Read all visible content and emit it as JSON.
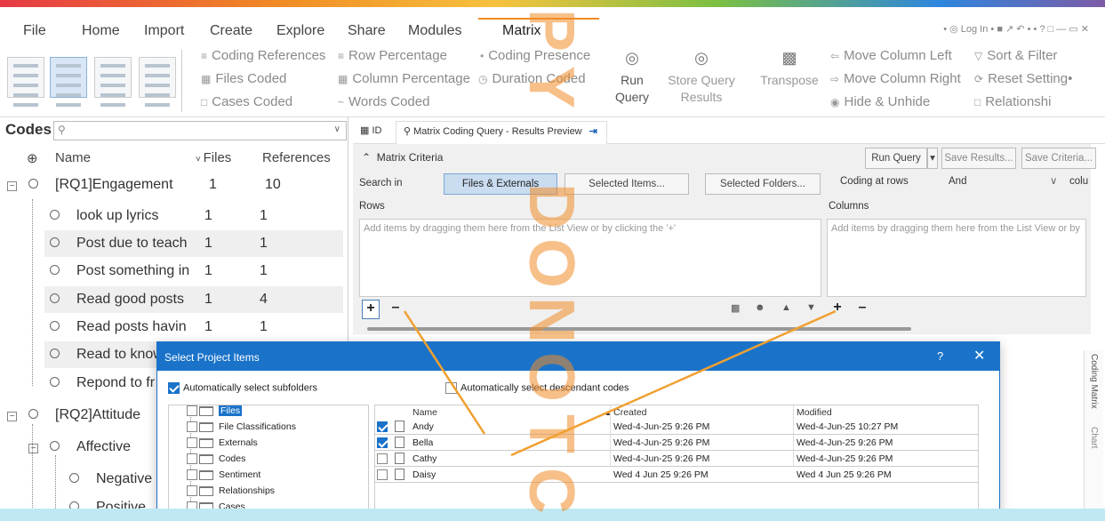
{
  "menu": {
    "items": [
      "File",
      "Home",
      "Import",
      "Create",
      "Explore",
      "Share",
      "Modules",
      "Matrix"
    ],
    "active": "Matrix",
    "login": "Log In"
  },
  "ribbon": {
    "coding_references": "Coding References",
    "row_percentage": "Row Percentage",
    "coding_presence": "Coding Presence",
    "files_coded": "Files Coded",
    "column_percentage": "Column Percentage",
    "duration_coded": "Duration Coded",
    "cases_coded": "Cases Coded",
    "words_coded": "Words Coded",
    "run_query_1": "Run",
    "run_query_2": "Query",
    "store_query_1": "Store Query",
    "store_query_2": "Results",
    "transpose": "Transpose",
    "move_column_left": "Move Column Left",
    "move_column_right": "Move Column Right",
    "hide_unhide": "Hide & Unhide",
    "sort_filter": "Sort & Filter",
    "reset_settings": "Reset Setting•",
    "relationship": "Relationshi"
  },
  "codes_panel": {
    "title": "Codes",
    "columns": {
      "name": "Name",
      "files": "Files",
      "references": "References"
    },
    "rows": [
      {
        "name": "[RQ1]Engagement",
        "files": "1",
        "refs": "10"
      },
      {
        "name": "look up lyrics",
        "files": "1",
        "refs": "1"
      },
      {
        "name": "Post due to teach",
        "files": "1",
        "refs": "1"
      },
      {
        "name": "Post something in",
        "files": "1",
        "refs": "1"
      },
      {
        "name": "Read good posts",
        "files": "1",
        "refs": "4"
      },
      {
        "name": "Read posts havin",
        "files": "1",
        "refs": "1"
      },
      {
        "name": "Read to know",
        "files": "",
        "refs": ""
      },
      {
        "name": "Repond to fr",
        "files": "",
        "refs": ""
      },
      {
        "name": "[RQ2]Attitude",
        "files": "",
        "refs": ""
      },
      {
        "name": "Affective",
        "files": "",
        "refs": ""
      },
      {
        "name": "Negative",
        "files": "",
        "refs": ""
      },
      {
        "name": "Positive",
        "files": "",
        "refs": ""
      }
    ]
  },
  "tabs": {
    "id_tab": "ID",
    "results_tab": "Matrix Coding Query - Results Preview"
  },
  "criteria": {
    "title": "Matrix Criteria",
    "run_query": "Run Query",
    "save_results": "Save Results...",
    "save_criteria": "Save Criteria...",
    "search_in": "Search in",
    "files_externals": "Files & Externals",
    "selected_items": "Selected Items...",
    "selected_folders": "Selected Folders...",
    "coding_at_rows": "Coding at rows",
    "operator": "And",
    "colu": "colu",
    "rows_label": "Rows",
    "columns_label": "Columns",
    "rows_hint": "Add items by dragging them here from the List View or by clicking the '+'",
    "columns_hint": "Add items by dragging them here from the List View or by"
  },
  "side_tabs": {
    "coding_matrix": "Coding Matrix",
    "chart": "Chart"
  },
  "dialog": {
    "title": "Select Project Items",
    "help": "?",
    "close": "✕",
    "auto_subfolders": "Automatically select subfolders",
    "auto_descendants": "Automatically select descendant codes",
    "folders": [
      {
        "label": "Files",
        "checked": false,
        "selected": true
      },
      {
        "label": "File Classifications",
        "checked": false,
        "selected": false
      },
      {
        "label": "Externals",
        "checked": false,
        "selected": false
      },
      {
        "label": "Codes",
        "checked": false,
        "selected": false
      },
      {
        "label": "Sentiment",
        "checked": false,
        "selected": false
      },
      {
        "label": "Relationships",
        "checked": false,
        "selected": false
      },
      {
        "label": "Cases",
        "checked": false,
        "selected": false
      }
    ],
    "list_headers": {
      "name": "Name",
      "created": "Created",
      "modified": "Modified"
    },
    "files": [
      {
        "name": "Andy",
        "checked": true,
        "created": "Wed-4-Jun-25 9:26 PM",
        "modified": "Wed-4-Jun-25 10:27 PM"
      },
      {
        "name": "Bella",
        "checked": true,
        "created": "Wed-4-Jun-25 9:26 PM",
        "modified": "Wed-4-Jun-25 9:26 PM"
      },
      {
        "name": "Cathy",
        "checked": false,
        "created": "Wed-4-Jun-25 9:26 PM",
        "modified": "Wed-4-Jun-25 9:26 PM"
      },
      {
        "name": "Daisy",
        "checked": false,
        "created": "Wed 4 Jun 25 9:26 PM",
        "modified": "Wed 4 Jun 25 9:26 PM"
      }
    ]
  },
  "watermark": [
    "P",
    "Y",
    "D",
    "O",
    "N",
    "O",
    "T",
    "C"
  ],
  "colors": {
    "accent": "#1a73c9",
    "watermark": "#f08a24",
    "bottom_bar": "#bfe8f4"
  }
}
